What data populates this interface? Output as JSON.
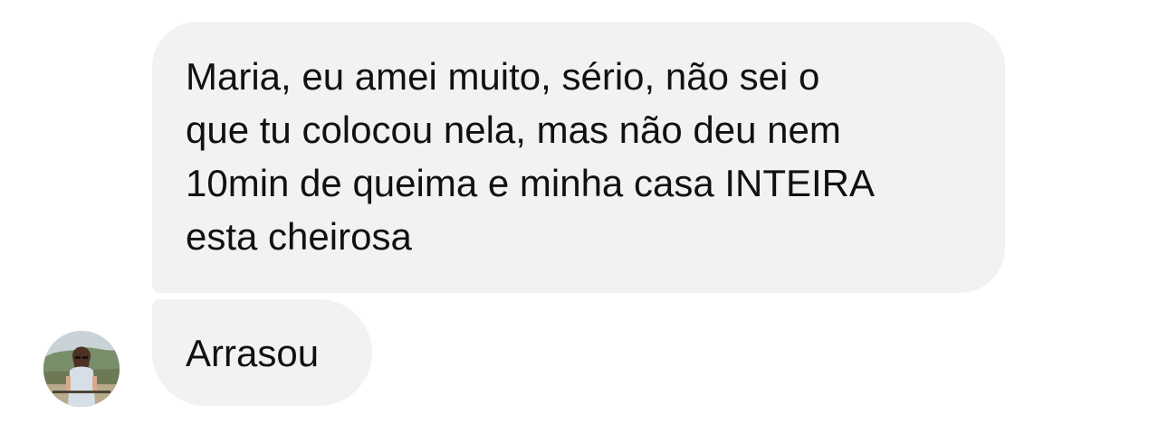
{
  "messages": [
    {
      "text": "Maria, eu amei muito, sério, não sei o\nque tu colocou nela, mas não deu nem\n10min de queima e minha casa INTEIRA\nesta cheirosa"
    },
    {
      "text": "Arrasou"
    }
  ],
  "sender": {
    "avatar_icon": "user-photo-avatar"
  },
  "colors": {
    "bubble": "#f1f2f4",
    "text": "#111111",
    "background": "#ffffff"
  }
}
